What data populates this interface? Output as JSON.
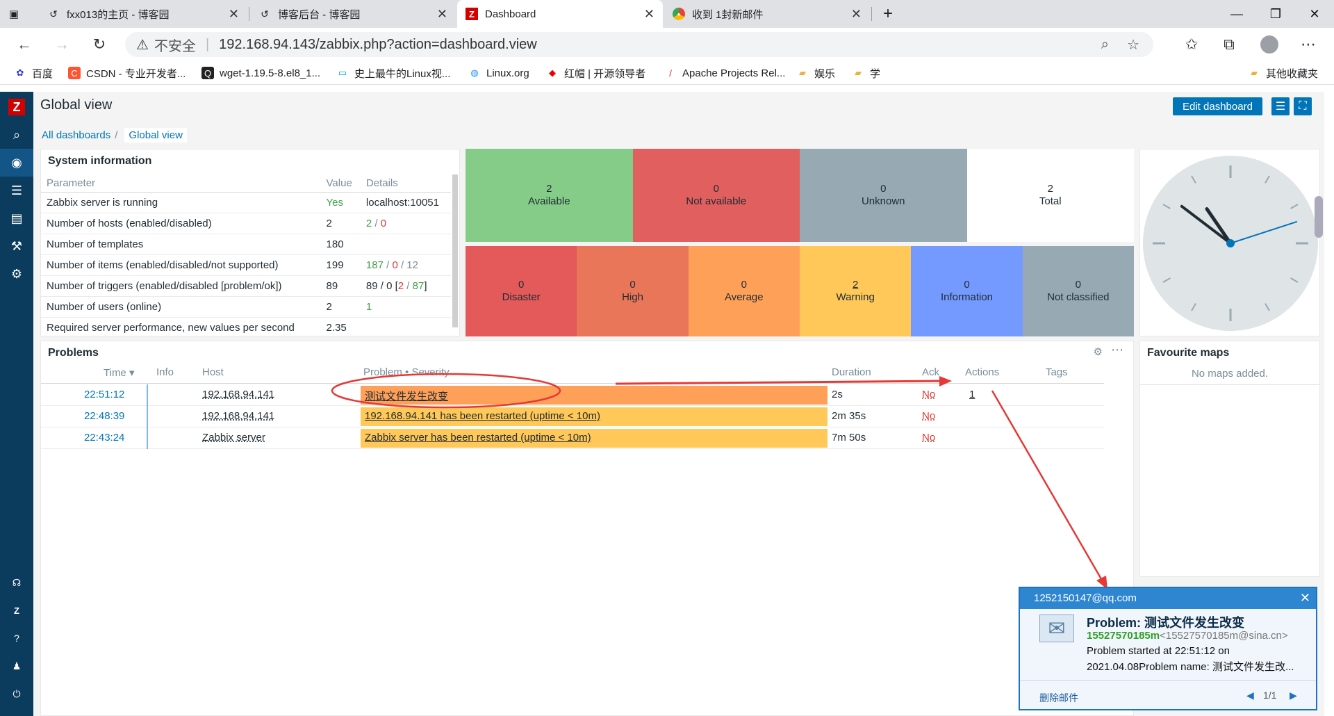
{
  "browser": {
    "tabs": [
      {
        "title": "fxx013的主页 - 博客园",
        "icon": "cnblogs-icon"
      },
      {
        "title": "博客后台 - 博客园",
        "icon": "cnblogs-icon"
      },
      {
        "title": "Dashboard",
        "icon": "zabbix-icon"
      },
      {
        "title": "收到 1封新邮件",
        "icon": "mail-app-icon"
      }
    ],
    "security_label": "不安全",
    "url": "192.168.94.143/zabbix.php?action=dashboard.view",
    "bookmarks": [
      "百度",
      "CSDN - 专业开发者...",
      "wget-1.19.5-8.el8_1...",
      "史上最牛的Linux视...",
      "Linux.org",
      "红帽 | 开源领导者",
      "Apache Projects Rel...",
      "娱乐",
      "学"
    ],
    "other_bookmarks": "其他收藏夹"
  },
  "sidebar": {
    "logo": "Z"
  },
  "header": {
    "title": "Global view",
    "edit_button": "Edit dashboard"
  },
  "breadcrumb": {
    "all": "All dashboards",
    "separator": "/",
    "current": "Global view"
  },
  "system_info": {
    "title": "System information",
    "columns": [
      "Parameter",
      "Value",
      "Details"
    ],
    "rows": [
      {
        "param": "Zabbix server is running",
        "value": "Yes",
        "d1": "localhost:10051",
        "d2": "",
        "d3": "",
        "d4": "",
        "d5": "",
        "d6": "",
        "d7": ""
      },
      {
        "param": "Number of hosts (enabled/disabled)",
        "value": "2",
        "d1": "",
        "d2": "2",
        "d3": " / ",
        "d4": "0",
        "d5": "",
        "d6": "",
        "d7": ""
      },
      {
        "param": "Number of templates",
        "value": "180",
        "d1": "",
        "d2": "",
        "d3": "",
        "d4": "",
        "d5": "",
        "d6": "",
        "d7": ""
      },
      {
        "param": "Number of items (enabled/disabled/not supported)",
        "value": "199",
        "d1": "",
        "d2": "187",
        "d3": " / ",
        "d4": "0",
        "d5": " / ",
        "d6": "12",
        "d7": ""
      },
      {
        "param": "Number of triggers (enabled/disabled [problem/ok])",
        "value": "89",
        "d1": "89 / 0 [",
        "d2": "",
        "d3": "",
        "d4": "2",
        "d5": " / ",
        "d6": "87",
        "d7": "]"
      },
      {
        "param": "Number of users (online)",
        "value": "2",
        "d1": "",
        "d2": "1",
        "d3": "",
        "d4": "",
        "d5": "",
        "d6": "",
        "d7": ""
      },
      {
        "param": "Required server performance, new values per second",
        "value": "2.35",
        "d1": "",
        "d2": "",
        "d3": "",
        "d4": "",
        "d5": "",
        "d6": "",
        "d7": ""
      }
    ]
  },
  "host_availability": [
    {
      "count": "2",
      "label": "Available",
      "color": "#86cc89"
    },
    {
      "count": "0",
      "label": "Not available",
      "color": "#e15f5f"
    },
    {
      "count": "0",
      "label": "Unknown",
      "color": "#97aab3"
    },
    {
      "count": "2",
      "label": "Total",
      "color": "#ffffff"
    }
  ],
  "problems_by_severity": [
    {
      "count": "0",
      "label": "Disaster",
      "color": "#e45959"
    },
    {
      "count": "0",
      "label": "High",
      "color": "#e97659"
    },
    {
      "count": "0",
      "label": "Average",
      "color": "#ffa059"
    },
    {
      "count": "2",
      "label": "Warning",
      "color": "#ffc859"
    },
    {
      "count": "0",
      "label": "Information",
      "color": "#7499ff"
    },
    {
      "count": "0",
      "label": "Not classified",
      "color": "#97aab3"
    }
  ],
  "clock": {
    "hour": 22,
    "minute": 51,
    "second": 12
  },
  "problems": {
    "title": "Problems",
    "columns": {
      "time": "Time",
      "info": "Info",
      "host": "Host",
      "problem": "Problem • Severity",
      "duration": "Duration",
      "ack": "Ack",
      "actions": "Actions",
      "tags": "Tags"
    },
    "rows": [
      {
        "time": "22:51:12",
        "host": "192.168.94.141",
        "problem": "测试文件发生改变",
        "duration": "2s",
        "ack": "No",
        "actions": "1",
        "color": "#ffa059"
      },
      {
        "time": "22:48:39",
        "host": "192.168.94.141",
        "problem": "192.168.94.141 has been restarted (uptime < 10m)",
        "duration": "2m 35s",
        "ack": "No",
        "actions": "",
        "color": "#ffc859"
      },
      {
        "time": "22:43:24",
        "host": "Zabbix server",
        "problem": "Zabbix server has been restarted (uptime < 10m)",
        "duration": "7m 50s",
        "ack": "No",
        "actions": "",
        "color": "#ffc859"
      }
    ]
  },
  "favourite_maps": {
    "title": "Favourite maps",
    "empty": "No maps added."
  },
  "mail_popup": {
    "account": "1252150147@qq.com",
    "subject": "Problem: 测试文件发生改变",
    "sender_name": "15527570185m",
    "sender_email": "<15527570185m@sina.cn>",
    "body1": "Problem started at 22:51:12 on",
    "body2": "2021.04.08Problem name: 测试文件发生改...",
    "delete": "删除邮件",
    "pager": "1/1"
  }
}
